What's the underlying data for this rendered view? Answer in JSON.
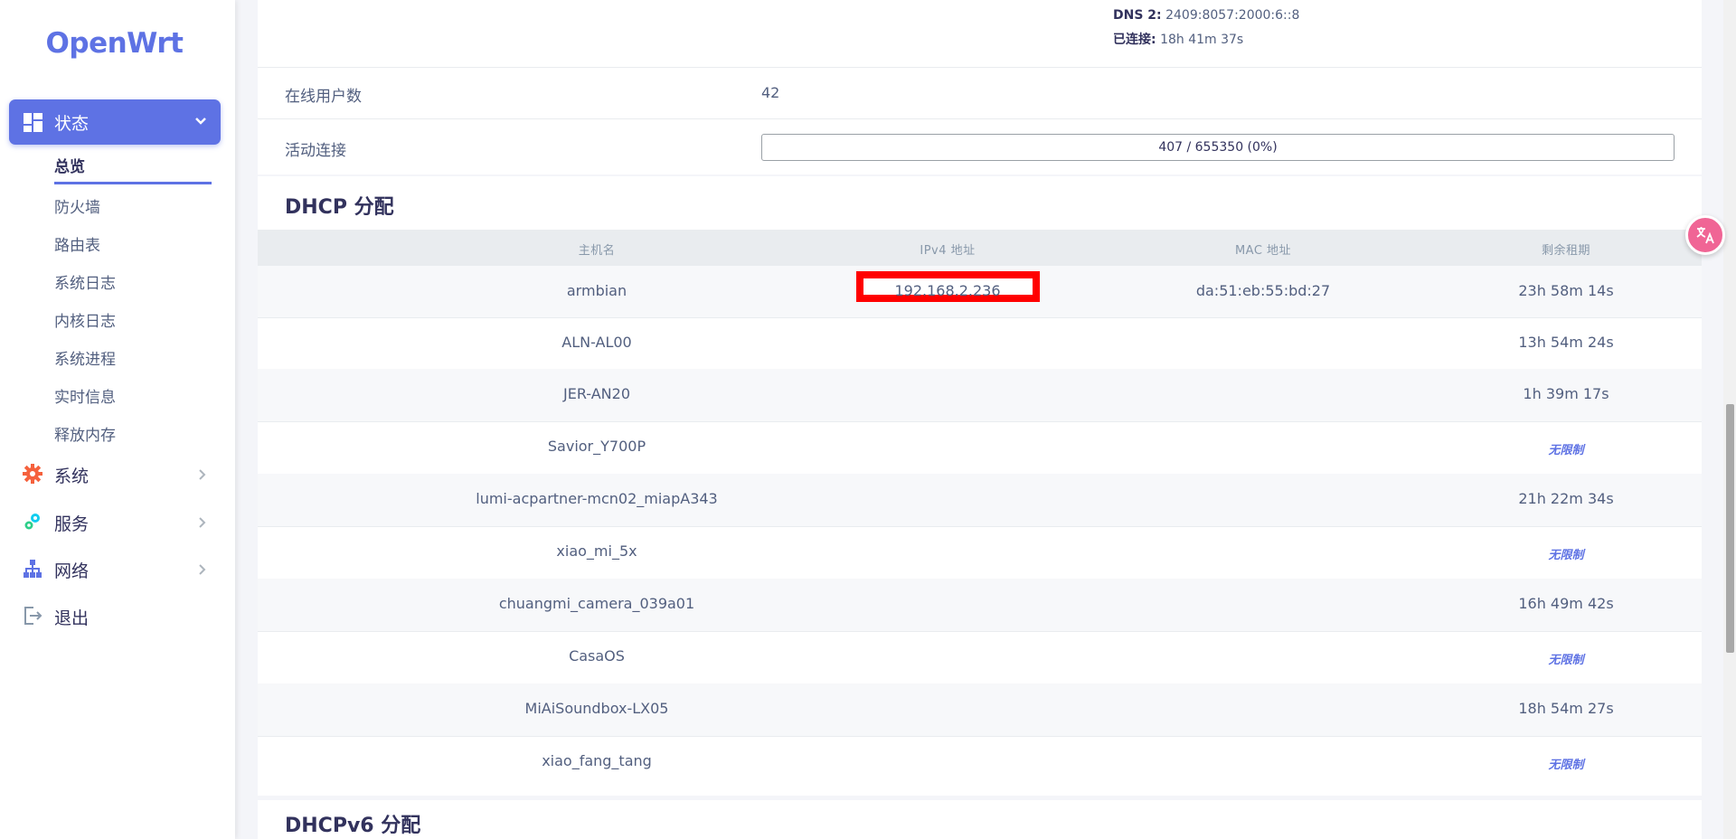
{
  "sidebar": {
    "brand": "OpenWrt",
    "active": {
      "label": "状态",
      "icon": "dashboard-icon"
    },
    "subitems": [
      "总览",
      "防火墙",
      "路由表",
      "系统日志",
      "内核日志",
      "系统进程",
      "实时信息",
      "释放内存"
    ],
    "items": [
      {
        "label": "系统",
        "icon": "gear-icon"
      },
      {
        "label": "服务",
        "icon": "services-gears-icon"
      },
      {
        "label": "网络",
        "icon": "network-tree-icon"
      },
      {
        "label": "退出",
        "icon": "logout-icon"
      }
    ]
  },
  "network": {
    "dns2_label": "DNS 2:",
    "dns2_value": "2409:8057:2000:6::8",
    "connected_label": "已连接:",
    "connected_value": "18h 41m 37s"
  },
  "summary": {
    "online_users_label": "在线用户数",
    "online_users_value": "42",
    "active_connections_label": "活动连接",
    "active_connections_value": "407 / 655350 (0%)",
    "active_connections_fraction": 0.0006
  },
  "dhcp": {
    "title": "DHCP 分配",
    "headers": [
      "主机名",
      "IPv4 地址",
      "MAC 地址",
      "剩余租期"
    ],
    "rows": [
      {
        "host": "armbian",
        "ip": "192.168.2.236",
        "mac": "da:51:eb:55:bd:27",
        "lease": "23h 58m 14s"
      },
      {
        "host": "ALN-AL00",
        "ip": "",
        "mac": "",
        "lease": "13h 54m 24s"
      },
      {
        "host": "JER-AN20",
        "ip": "",
        "mac": "",
        "lease": "1h 39m 17s"
      },
      {
        "host": "Savior_Y700P",
        "ip": "",
        "mac": "",
        "lease": "无限制"
      },
      {
        "host": "lumi-acpartner-mcn02_miapA343",
        "ip": "",
        "mac": "",
        "lease": "21h 22m 34s"
      },
      {
        "host": "xiao_mi_5x",
        "ip": "",
        "mac": "",
        "lease": "无限制"
      },
      {
        "host": "chuangmi_camera_039a01",
        "ip": "",
        "mac": "",
        "lease": "16h 49m 42s"
      },
      {
        "host": "CasaOS",
        "ip": "",
        "mac": "",
        "lease": "无限制"
      },
      {
        "host": "MiAiSoundbox-LX05",
        "ip": "",
        "mac": "",
        "lease": "18h 54m 27s"
      },
      {
        "host": "xiao_fang_tang",
        "ip": "",
        "mac": "",
        "lease": "无限制"
      }
    ]
  },
  "dhcpv6": {
    "title": "DHCPv6 分配"
  },
  "colors": {
    "accent": "#5e72e4",
    "highlight": "#ff0000",
    "float_button": "#f06595"
  }
}
